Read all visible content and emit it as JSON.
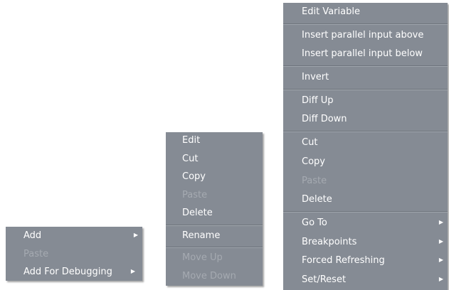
{
  "menu1": {
    "items": [
      {
        "label": "Add",
        "disabled": false,
        "submenu": true
      },
      {
        "label": "Paste",
        "disabled": true,
        "submenu": false
      },
      {
        "label": "Add For Debugging",
        "disabled": false,
        "submenu": true
      }
    ]
  },
  "menu2": {
    "items": [
      {
        "label": "Edit"
      },
      {
        "label": "Cut"
      },
      {
        "label": "Copy"
      },
      {
        "label": "Paste"
      },
      {
        "label": "Delete"
      },
      {
        "label": "Rename"
      },
      {
        "label": "Move Up"
      },
      {
        "label": "Move Down"
      }
    ]
  },
  "menu3": {
    "items": [
      {
        "label": "Edit Variable"
      },
      {
        "label": "Insert parallel input above"
      },
      {
        "label": "Insert parallel input below"
      },
      {
        "label": "Invert"
      },
      {
        "label": "Diff Up"
      },
      {
        "label": "Diff Down"
      },
      {
        "label": "Cut"
      },
      {
        "label": "Copy"
      },
      {
        "label": "Paste"
      },
      {
        "label": "Delete"
      },
      {
        "label": "Go To"
      },
      {
        "label": "Breakpoints"
      },
      {
        "label": "Forced Refreshing"
      },
      {
        "label": "Set/Reset"
      }
    ]
  },
  "submenu_arrow": "▶",
  "colors": {
    "menu_bg": "#858b94",
    "text": "#ffffff",
    "disabled_text": "#a5aab1"
  }
}
